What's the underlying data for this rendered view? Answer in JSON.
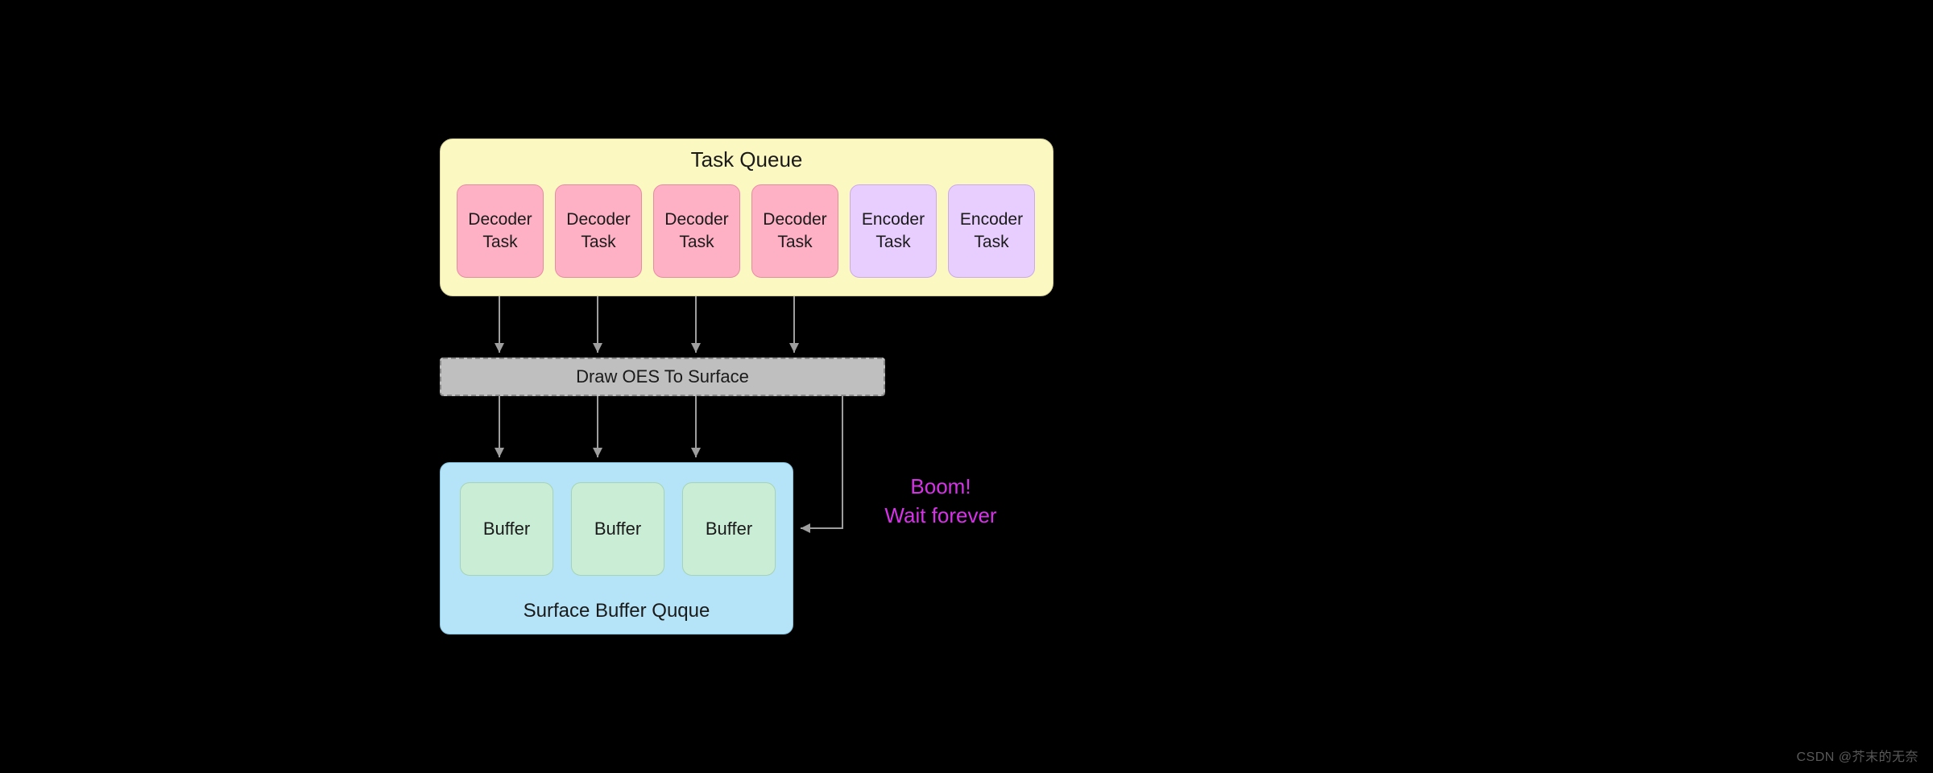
{
  "taskQueue": {
    "title": "Task Queue",
    "tasks": [
      {
        "type": "decoder",
        "line1": "Decoder",
        "line2": "Task"
      },
      {
        "type": "decoder",
        "line1": "Decoder",
        "line2": "Task"
      },
      {
        "type": "decoder",
        "line1": "Decoder",
        "line2": "Task"
      },
      {
        "type": "decoder",
        "line1": "Decoder",
        "line2": "Task"
      },
      {
        "type": "encoder",
        "line1": "Encoder",
        "line2": "Task"
      },
      {
        "type": "encoder",
        "line1": "Encoder",
        "line2": "Task"
      }
    ]
  },
  "drawBox": {
    "label": "Draw OES To Surface"
  },
  "bufferQueue": {
    "title": "Surface Buffer Quque",
    "buffers": [
      {
        "label": "Buffer"
      },
      {
        "label": "Buffer"
      },
      {
        "label": "Buffer"
      }
    ]
  },
  "annotation": {
    "line1": "Boom!",
    "line2": "Wait forever"
  },
  "watermark": "CSDN @芥末的无奈"
}
